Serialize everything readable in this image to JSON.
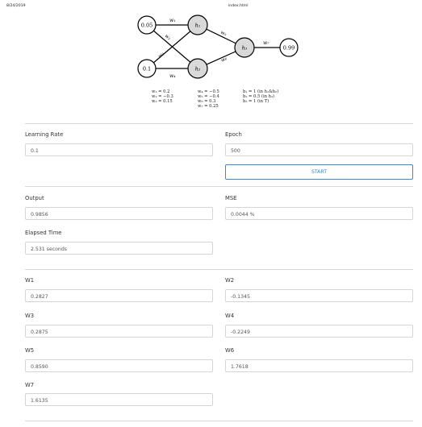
{
  "header": {
    "date": "8/24/2019",
    "filename": "index.html"
  },
  "diagram": {
    "inputs": [
      "0.05",
      "0.1"
    ],
    "hidden": [
      "h₁",
      "h₂",
      "h₃"
    ],
    "output": "0.99",
    "edge_labels": [
      "w₁",
      "w₂",
      "w₃",
      "w₄",
      "w₅",
      "w₆",
      "w₇"
    ],
    "weights_col1": [
      "w₁ = 0.2",
      "w₂ = −0.3",
      "w₃ = 0.15"
    ],
    "weights_col2": [
      "w₄ = −0.5",
      "w₅ = −0.4",
      "w₆ = 0.3",
      "w₇ = 0.25"
    ],
    "biases": [
      "b₁ = 1 (in h₁&h₂)",
      "b₂ = 0.5 (in h₃)",
      "b₃ = 1 (in T)"
    ]
  },
  "form": {
    "learning_rate": {
      "label": "Learning Rate",
      "value": "0.1"
    },
    "epoch": {
      "label": "Epoch",
      "value": "500"
    },
    "start_label": "START"
  },
  "results": {
    "output": {
      "label": "Output",
      "value": "0.9856"
    },
    "mse": {
      "label": "MSE",
      "value": "0.0044 %"
    },
    "elapsed": {
      "label": "Elapsed Time",
      "value": "2.531 seconds"
    }
  },
  "weights": {
    "w1": {
      "label": "W1",
      "value": "0.2827"
    },
    "w2": {
      "label": "W2",
      "value": "-0.1345"
    },
    "w3": {
      "label": "W3",
      "value": "0.2875"
    },
    "w4": {
      "label": "W4",
      "value": "-0.2249"
    },
    "w5": {
      "label": "W5",
      "value": "0.8590"
    },
    "w6": {
      "label": "W6",
      "value": "1.7618"
    },
    "w7": {
      "label": "W7",
      "value": "1.6135"
    }
  }
}
